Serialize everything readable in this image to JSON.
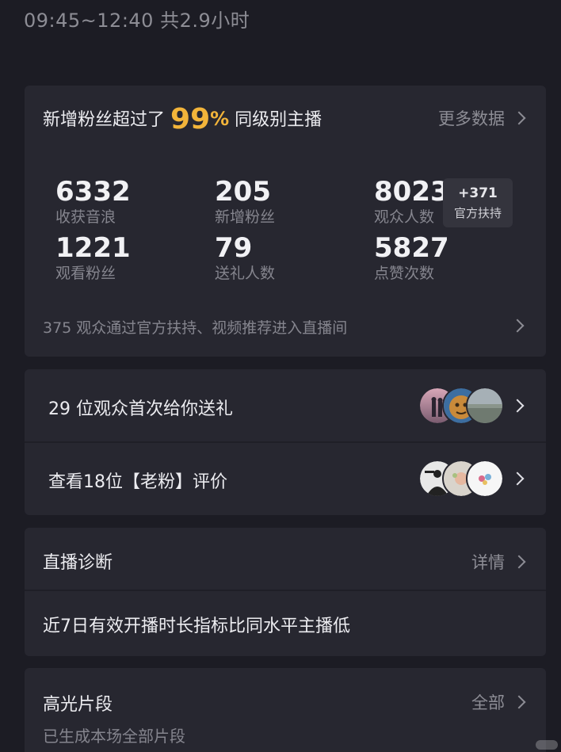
{
  "header": {
    "time_range": "09:45~12:40 共2.9小时"
  },
  "summary": {
    "prefix": "新增粉丝超过了",
    "percent": "99",
    "percent_sign": "%",
    "suffix": "同级别主播",
    "more_label": "更多数据",
    "stats": [
      {
        "value": "6332",
        "label": "收获音浪"
      },
      {
        "value": "205",
        "label": "新增粉丝"
      },
      {
        "value": "8023",
        "label": "观众人数"
      },
      {
        "value": "1221",
        "label": "观看粉丝"
      },
      {
        "value": "79",
        "label": "送礼人数"
      },
      {
        "value": "5827",
        "label": "点赞次数"
      }
    ],
    "boost": {
      "value": "+371",
      "label": "官方扶持"
    },
    "footer": "375 观众通过官方扶持、视频推荐进入直播间"
  },
  "gifts": {
    "first_gift_text": "29 位观众首次给你送礼",
    "old_fans_text": "查看18位【老粉】评价"
  },
  "diagnosis": {
    "title": "直播诊断",
    "detail_label": "详情",
    "message": "近7日有效开播时长指标比同水平主播低"
  },
  "highlights": {
    "title": "高光片段",
    "all_label": "全部",
    "subtitle": "已生成本场全部片段"
  }
}
